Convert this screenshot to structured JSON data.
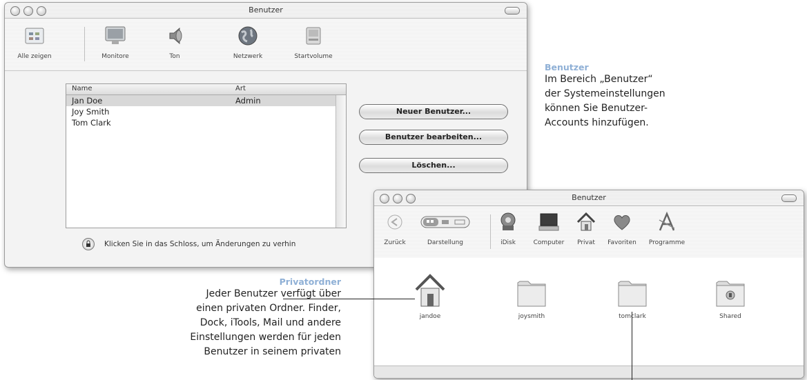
{
  "prefs_window": {
    "title": "Benutzer",
    "toolbar": [
      {
        "label": "Alle zeigen",
        "icon": "show-all-icon"
      },
      {
        "label": "Monitore",
        "icon": "monitor-icon"
      },
      {
        "label": "Ton",
        "icon": "speaker-icon"
      },
      {
        "label": "Netzwerk",
        "icon": "network-globe-icon"
      },
      {
        "label": "Startvolume",
        "icon": "startup-disk-icon"
      }
    ],
    "table": {
      "headers": [
        "Name",
        "Art"
      ],
      "rows": [
        {
          "name": "Jan Doe",
          "type": "Admin",
          "selected": true
        },
        {
          "name": "Joy Smith",
          "type": ""
        },
        {
          "name": "Tom Clark",
          "type": ""
        }
      ]
    },
    "buttons": {
      "new_user": "Neuer Benutzer...",
      "edit_user": "Benutzer bearbeiten...",
      "delete": "Löschen..."
    },
    "lock_text": "Klicken Sie in das Schloss, um Änderungen zu verhin"
  },
  "finder_window": {
    "title": "Benutzer",
    "toolbar": [
      {
        "label": "Zurück",
        "icon": "back-arrow-icon"
      },
      {
        "label": "Darstellung",
        "icon": "view-mode-icon"
      },
      {
        "label": "iDisk",
        "icon": "idisk-icon"
      },
      {
        "label": "Computer",
        "icon": "computer-icon"
      },
      {
        "label": "Privat",
        "icon": "home-icon"
      },
      {
        "label": "Favoriten",
        "icon": "favorites-heart-icon"
      },
      {
        "label": "Programme",
        "icon": "applications-icon"
      }
    ],
    "items": [
      {
        "label": "jandoe",
        "icon": "home-folder-icon"
      },
      {
        "label": "joysmith",
        "icon": "folder-icon"
      },
      {
        "label": "tomclark",
        "icon": "folder-icon"
      },
      {
        "label": "Shared",
        "icon": "shared-folder-icon"
      }
    ]
  },
  "annotations": {
    "benutzer": {
      "title": "Benutzer",
      "lines": [
        "Im Bereich „Benutzer“",
        "der Systemeinstellungen",
        "können Sie Benutzer-",
        "Accounts hinzufügen."
      ]
    },
    "privatordner": {
      "title": "Privatordner",
      "lines": [
        "Jeder Benutzer verfügt über",
        "einen privaten Ordner. Finder,",
        "Dock, iTools, Mail und andere",
        "Einstellungen werden für jeden",
        "Benutzer in seinem privaten"
      ]
    }
  }
}
